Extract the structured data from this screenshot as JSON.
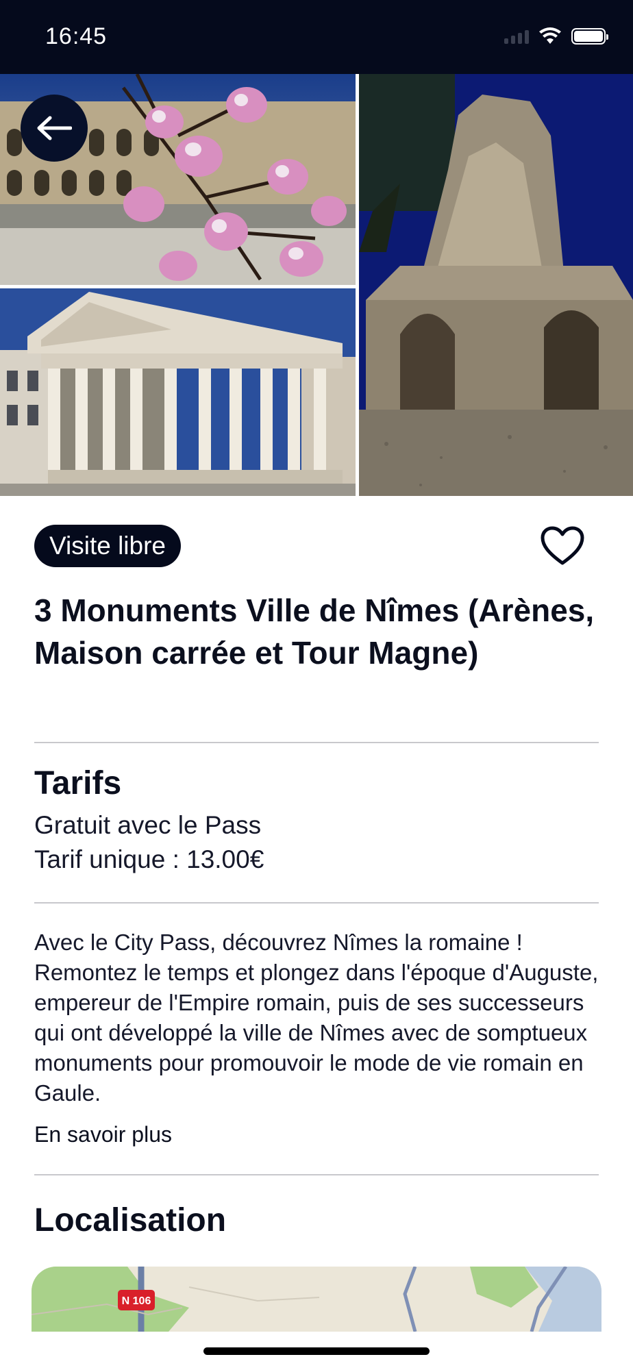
{
  "status_bar": {
    "time": "16:45",
    "icons": [
      "signal-icon",
      "wifi-icon",
      "battery-icon"
    ]
  },
  "gallery": {
    "photos": [
      "arenes-photo",
      "maison-carree-photo",
      "tour-magne-photo"
    ]
  },
  "header": {
    "back_icon": "arrow-left-icon"
  },
  "attraction": {
    "tag": "Visite libre",
    "favorite_icon": "heart-outline-icon",
    "title": "3 Monuments Ville de Nîmes (Arènes, Maison carrée et Tour Magne)"
  },
  "tarifs": {
    "title": "Tarifs",
    "lines": [
      "Gratuit avec le Pass",
      "Tarif unique : 13.00€"
    ]
  },
  "description": {
    "text": "Avec le City Pass, découvrez Nîmes la romaine ! Remontez le temps et plongez dans l'époque d'Auguste, empereur de l'Empire romain, puis de ses successeurs qui ont développé la ville de Nîmes avec de somptueux monuments pour promouvoir le mode de vie romain en Gaule.",
    "more_link": "En savoir plus"
  },
  "localisation": {
    "title": "Localisation",
    "map_road_label": "N 106"
  },
  "colors": {
    "dark_navy": "#050a1c",
    "text": "#0b0f1e",
    "divider": "#c8c8cc",
    "road_badge": "#d9202a"
  }
}
